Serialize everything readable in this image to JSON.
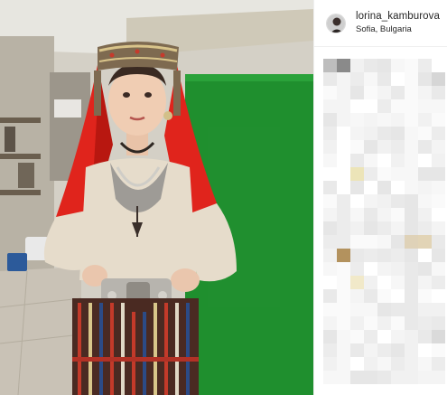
{
  "post": {
    "username": "lorina_kamburova",
    "location": "Sofia, Bulgaria"
  },
  "colors": {
    "backdrop_green": "#1f8f2e",
    "scarf_red": "#e0241c",
    "blouse": "#e6dccb",
    "silver": "#b9b6b0",
    "border": "#efefef",
    "text": "#262626"
  },
  "icons": {
    "avatar": "profile-photo",
    "comments": "pixelated-blurred-comments"
  }
}
